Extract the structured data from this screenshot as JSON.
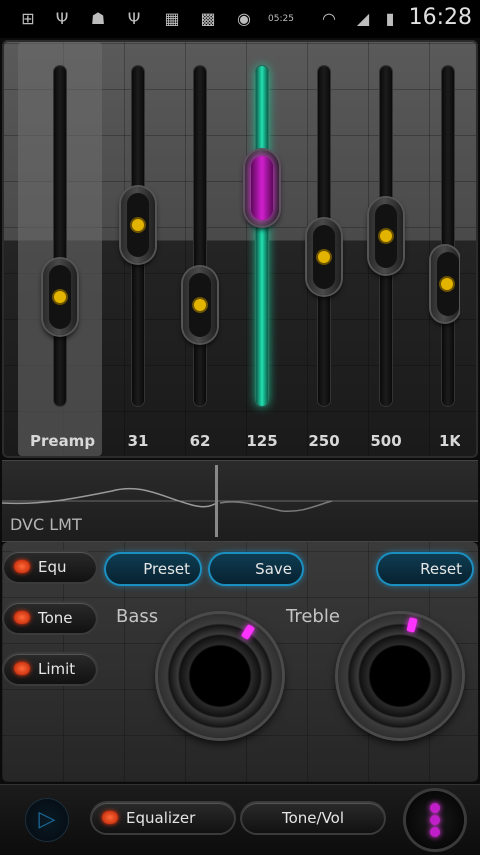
{
  "status_bar": {
    "icons": [
      "add-icon",
      "usb-icon",
      "android-debug-icon",
      "usb-icon",
      "music-icon",
      "app-icon",
      "camera-icon",
      "clock-widget-icon",
      "wifi-icon",
      "signal-icon",
      "battery-charging-icon"
    ],
    "clock_widget_text": "05:25",
    "time": "16:28"
  },
  "equalizer": {
    "bands": [
      {
        "label": "Preamp",
        "level": 0.27
      },
      {
        "label": "31",
        "level": 0.54
      },
      {
        "label": "62",
        "level": 0.24
      },
      {
        "label": "125",
        "level": 0.68,
        "active": true
      },
      {
        "label": "250",
        "level": 0.42
      },
      {
        "label": "500",
        "level": 0.5
      },
      {
        "label": "1K",
        "level": 0.32
      }
    ],
    "active_color": "#d21ed0",
    "fill_color": "#22e0b0",
    "knob_dot_color": "#e2b400"
  },
  "dvc": {
    "label": "DVC LMT"
  },
  "controls": {
    "mode_buttons": [
      "Equ",
      "Tone",
      "Limit"
    ],
    "action_buttons": {
      "preset": "Preset",
      "save": "Save",
      "reset": "Reset"
    },
    "bass_label": "Bass",
    "treble_label": "Treble",
    "bass_level": 0.62,
    "treble_level": 0.55
  },
  "bottom_bar": {
    "play_icon": "play-icon",
    "tab_equalizer": "Equalizer",
    "tab_tonevol": "Tone/Vol",
    "menu_icon": "menu-dots-icon"
  }
}
